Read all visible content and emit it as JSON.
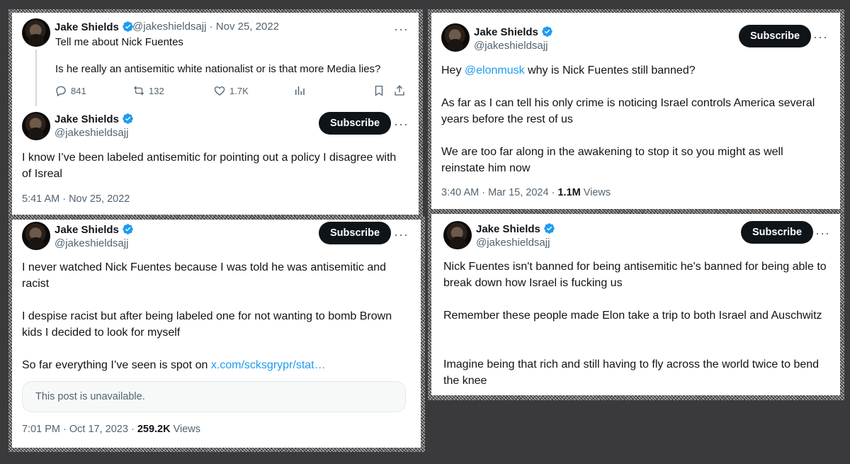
{
  "author": {
    "name": "Jake Shields",
    "handle": "@jakeshieldsajj"
  },
  "subscribe_label": "Subscribe",
  "more_label": "···",
  "card1": {
    "quoted": {
      "handle_date": "@jakeshieldsajj · Nov 25, 2022",
      "line1": "Tell me about Nick Fuentes",
      "line2": "Is he really an antisemitic white nationalist or is that more Media lies?",
      "replies": "841",
      "reposts": "132",
      "likes": "1.7K"
    },
    "text": "I know I’ve been labeled antisemitic for pointing out a policy I disagree with of Isreal",
    "timestamp": "5:41 AM · Nov 25, 2022"
  },
  "card2": {
    "para1": "I never watched Nick Fuentes because I was told he was antisemitic and racist",
    "para2": "I despise racist but after being labeled one for not wanting to bomb Brown kids I decided to look for myself",
    "para3_prefix": "So far everything I’ve seen is spot on ",
    "para3_link": "x.com/scksgrypr/stat…",
    "unavailable": "This post is unavailable.",
    "timestamp": "7:01 PM · Oct 17, 2023 · ",
    "views": "259.2K",
    "views_label": " Views"
  },
  "card3": {
    "para1_prefix": "Hey ",
    "para1_mention": "@elonmusk",
    "para1_suffix": " why is Nick Fuentes still banned?",
    "para2": "As far as I can tell his only crime is noticing Israel controls America several years before the rest of us",
    "para3": "We are too far along in the awakening to stop it so you might as well reinstate him now",
    "timestamp": "3:40 AM · Mar 15, 2024 · ",
    "views": "1.1M",
    "views_label": " Views"
  },
  "card4": {
    "para1": "Nick Fuentes isn't banned for being antisemitic he's banned for being able to break down how Israel is fucking us",
    "para2": "Remember these people made Elon take a trip to both Israel and Auschwitz",
    "para3": "Imagine being that rich and still having to fly across the world twice to bend the knee"
  },
  "colors": {
    "background": "#3a3a3c",
    "accent": "#1d9bf0",
    "button": "#0f1419",
    "secondary_text": "#536471"
  }
}
